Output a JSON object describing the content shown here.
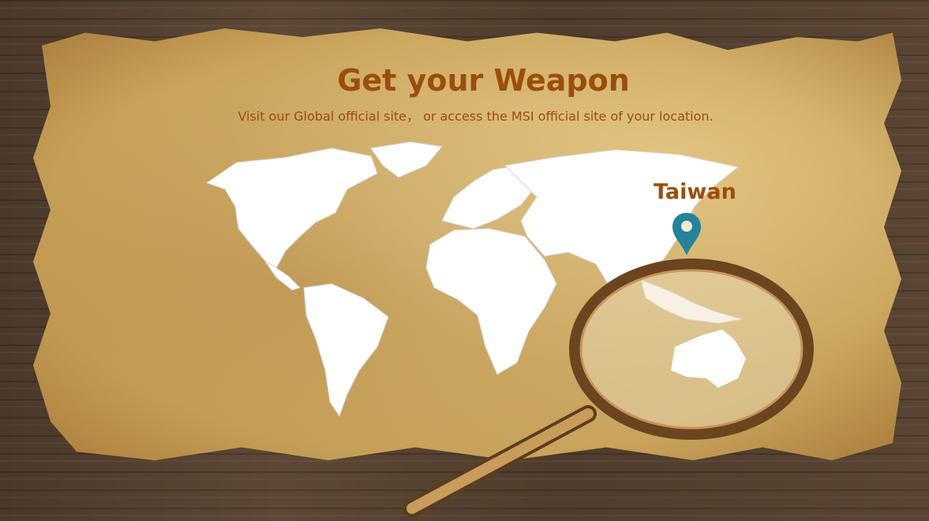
{
  "header": {
    "title": "Get your Weapon",
    "subtitle": "Visit our Global official site，  or access the MSI official site of your location."
  },
  "map": {
    "selected_location": "Taiwan",
    "pin_color": "#23849b",
    "title_color": "#9c4d0e"
  }
}
